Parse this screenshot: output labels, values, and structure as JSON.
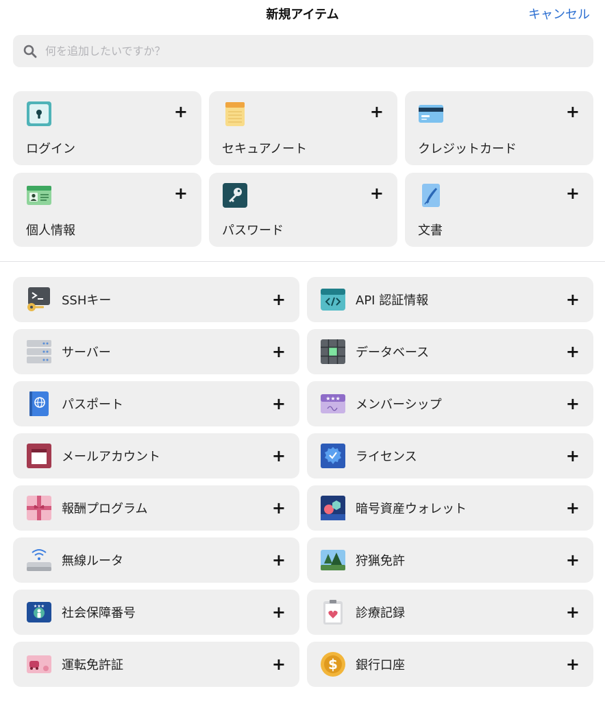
{
  "header": {
    "title": "新規アイテム",
    "cancel_label": "キャンセル"
  },
  "search": {
    "placeholder": "何を追加したいですか？",
    "value": ""
  },
  "plus_symbol": "+",
  "featured": [
    {
      "label": "ログイン",
      "icon": "login-icon"
    },
    {
      "label": "セキュアノート",
      "icon": "secure-note-icon"
    },
    {
      "label": "クレジットカード",
      "icon": "credit-card-icon"
    },
    {
      "label": "個人情報",
      "icon": "identity-icon"
    },
    {
      "label": "パスワード",
      "icon": "password-icon"
    },
    {
      "label": "文書",
      "icon": "document-icon"
    }
  ],
  "items": [
    {
      "label": "SSHキー",
      "icon": "ssh-key-icon"
    },
    {
      "label": "API 認証情報",
      "icon": "api-credential-icon"
    },
    {
      "label": "サーバー",
      "icon": "server-icon"
    },
    {
      "label": "データベース",
      "icon": "database-icon"
    },
    {
      "label": "パスポート",
      "icon": "passport-icon"
    },
    {
      "label": "メンバーシップ",
      "icon": "membership-icon"
    },
    {
      "label": "メールアカウント",
      "icon": "email-account-icon"
    },
    {
      "label": "ライセンス",
      "icon": "license-icon"
    },
    {
      "label": "報酬プログラム",
      "icon": "reward-program-icon"
    },
    {
      "label": "暗号資産ウォレット",
      "icon": "crypto-wallet-icon"
    },
    {
      "label": "無線ルータ",
      "icon": "wireless-router-icon"
    },
    {
      "label": "狩猟免許",
      "icon": "outdoor-license-icon"
    },
    {
      "label": "社会保障番号",
      "icon": "social-security-icon"
    },
    {
      "label": "診療記録",
      "icon": "medical-record-icon"
    },
    {
      "label": "運転免許証",
      "icon": "driver-license-icon"
    },
    {
      "label": "銀行口座",
      "icon": "bank-account-icon"
    }
  ],
  "colors": {
    "accent": "#2c6fd1",
    "card_bg": "#efefef"
  }
}
